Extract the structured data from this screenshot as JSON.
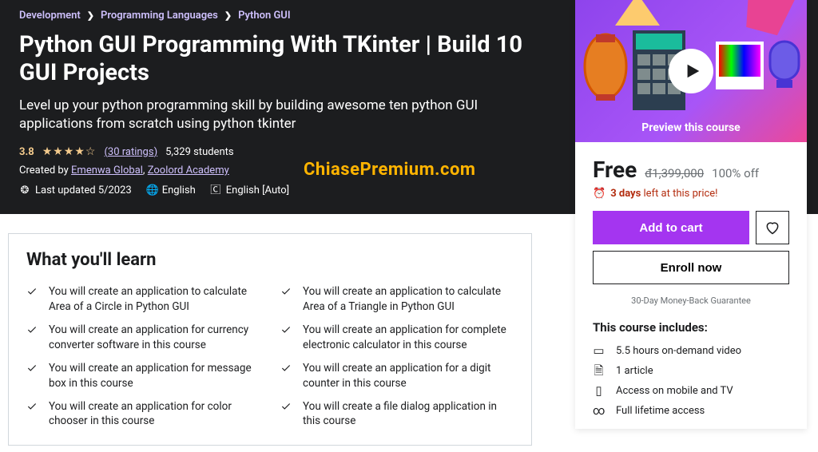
{
  "breadcrumb": {
    "items": [
      "Development",
      "Programming Languages",
      "Python GUI"
    ]
  },
  "hero": {
    "title": "Python GUI Programming With TKinter | Build 10 GUI Projects",
    "subtitle": "Level up your python programming skill by building awesome ten python GUI applications from scratch using python tkinter",
    "rating": "3.8",
    "ratings_count": "(30 ratings)",
    "students": "5,329 students",
    "created_by_prefix": "Created by ",
    "authors": [
      "Emenwa Global",
      "Zoolord Academy"
    ],
    "last_updated": "Last updated 5/2023",
    "language": "English",
    "captions": "English [Auto]"
  },
  "watermark": "ChiasePremium.com",
  "sidebar": {
    "preview_label": "Preview this course",
    "price_free": "Free",
    "price_old": "đ1,399,000",
    "price_off": "100% off",
    "alarm_days": "3 days",
    "alarm_suffix": " left at this price!",
    "add_to_cart": "Add to cart",
    "enroll": "Enroll now",
    "guarantee": "30-Day Money-Back Guarantee",
    "includes_title": "This course includes:",
    "includes": [
      "5.5 hours on-demand video",
      "1 article",
      "Access on mobile and TV",
      "Full lifetime access"
    ]
  },
  "learn": {
    "title": "What you'll learn",
    "items": [
      "You will create an application to calculate Area of a Circle in Python GUI",
      "You will create an application to calculate Area of a Triangle in Python GUI",
      "You will create an application for currency converter software in this course",
      "You will create an application for complete electronic calculator in this course",
      "You will create an application for message box in this course",
      "You will create an application for a digit counter in this course",
      "You will create an application for color chooser in this course",
      "You will create a file dialog application in this course"
    ]
  }
}
